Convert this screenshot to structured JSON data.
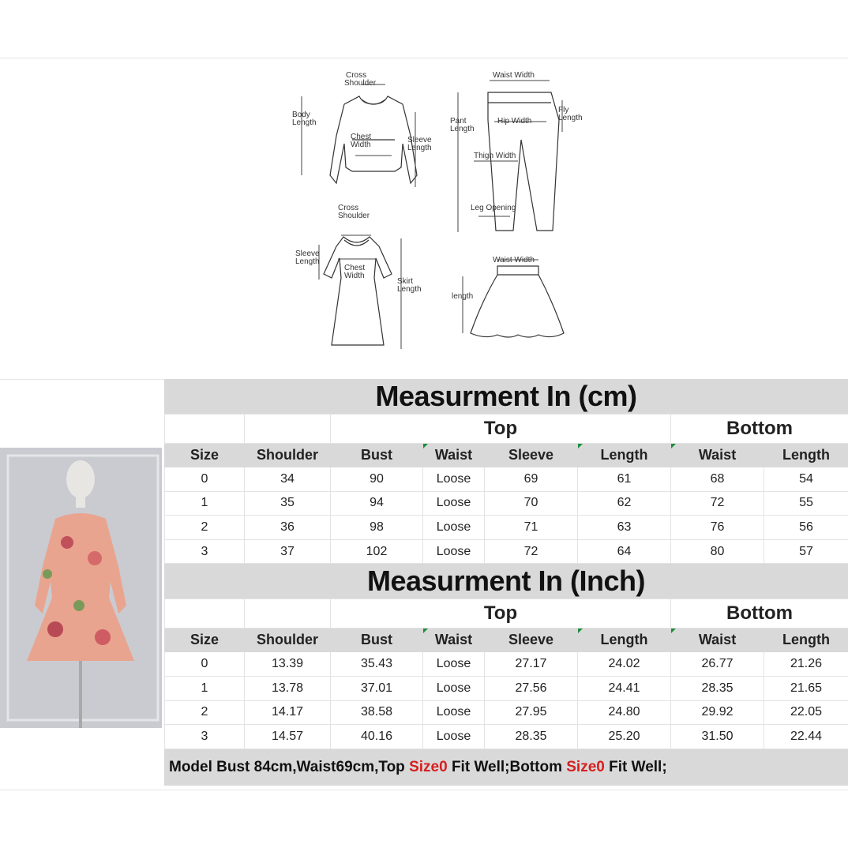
{
  "diagram_labels": {
    "cross_shoulder": "Cross\nShoulder",
    "body_length": "Body\nLength",
    "chest_width": "Chest\nWidth",
    "sleeve_length": "Sleeve\nLength",
    "waist_width": "Waist Width",
    "pant_length": "Pant\nLength",
    "fly_length": "Fly\nLength",
    "hip_width": "Hip Width",
    "thigh_width": "Thigh Width",
    "leg_opening": "Leg Opening",
    "dress_cross_shoulder": "Cross\nShoulder",
    "dress_sleeve_length": "Sleeve\nLength",
    "dress_chest_width": "Chest\nWidth",
    "skirt_length": "Skirt\nLength",
    "skirt_waist_width": "Waist Width",
    "skirt_length_label": "length"
  },
  "tables": [
    {
      "title": "Measurment In (cm)",
      "group_top": "Top",
      "group_bottom": "Bottom",
      "headers": [
        "Size",
        "Shoulder",
        "Bust",
        "Waist",
        "Sleeve",
        "Length",
        "Waist",
        "Length"
      ],
      "rows": [
        [
          "0",
          "34",
          "90",
          "Loose",
          "69",
          "61",
          "68",
          "54"
        ],
        [
          "1",
          "35",
          "94",
          "Loose",
          "70",
          "62",
          "72",
          "55"
        ],
        [
          "2",
          "36",
          "98",
          "Loose",
          "71",
          "63",
          "76",
          "56"
        ],
        [
          "3",
          "37",
          "102",
          "Loose",
          "72",
          "64",
          "80",
          "57"
        ]
      ]
    },
    {
      "title": "Measurment In (Inch)",
      "group_top": "Top",
      "group_bottom": "Bottom",
      "headers": [
        "Size",
        "Shoulder",
        "Bust",
        "Waist",
        "Sleeve",
        "Length",
        "Waist",
        "Length"
      ],
      "rows": [
        [
          "0",
          "13.39",
          "35.43",
          "Loose",
          "27.17",
          "24.02",
          "26.77",
          "21.26"
        ],
        [
          "1",
          "13.78",
          "37.01",
          "Loose",
          "27.56",
          "24.41",
          "28.35",
          "21.65"
        ],
        [
          "2",
          "14.17",
          "38.58",
          "Loose",
          "27.95",
          "24.80",
          "29.92",
          "22.05"
        ],
        [
          "3",
          "14.57",
          "40.16",
          "Loose",
          "28.35",
          "25.20",
          "31.50",
          "22.44"
        ]
      ]
    }
  ],
  "note": {
    "part1": "Model Bust 84cm,Waist69cm,Top ",
    "size1": "Size0",
    "part2": " Fit Well;Bottom ",
    "size2": "Size0",
    "part3": " Fit Well;"
  },
  "colors": {
    "header_bg": "#d9d9d9",
    "accent_red": "#d61f1f",
    "cell_marker": "#1e8c3a"
  }
}
